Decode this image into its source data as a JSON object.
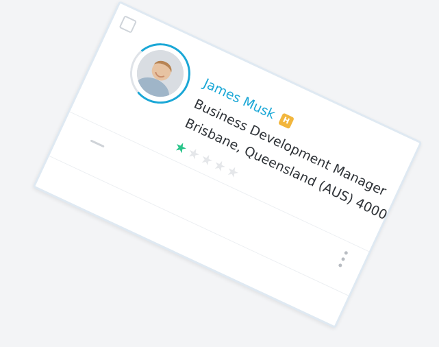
{
  "contact": {
    "name": "James Musk",
    "badge": "H",
    "title": "Business Development Manager",
    "location": "Brisbane, Queensland (AUS) 4000",
    "rating": 1,
    "rating_max": 5
  },
  "icons": {
    "select": "checkbox-icon",
    "avatar": "avatar-photo",
    "badge": "h-badge-icon",
    "rating": "star-icon",
    "collapse": "minus-icon",
    "more": "more-vertical-icon"
  },
  "colors": {
    "accent": "#1aa7d6",
    "badge": "#f2b63d",
    "star_active": "#29c48a",
    "star_inactive": "#e5e7ea"
  }
}
